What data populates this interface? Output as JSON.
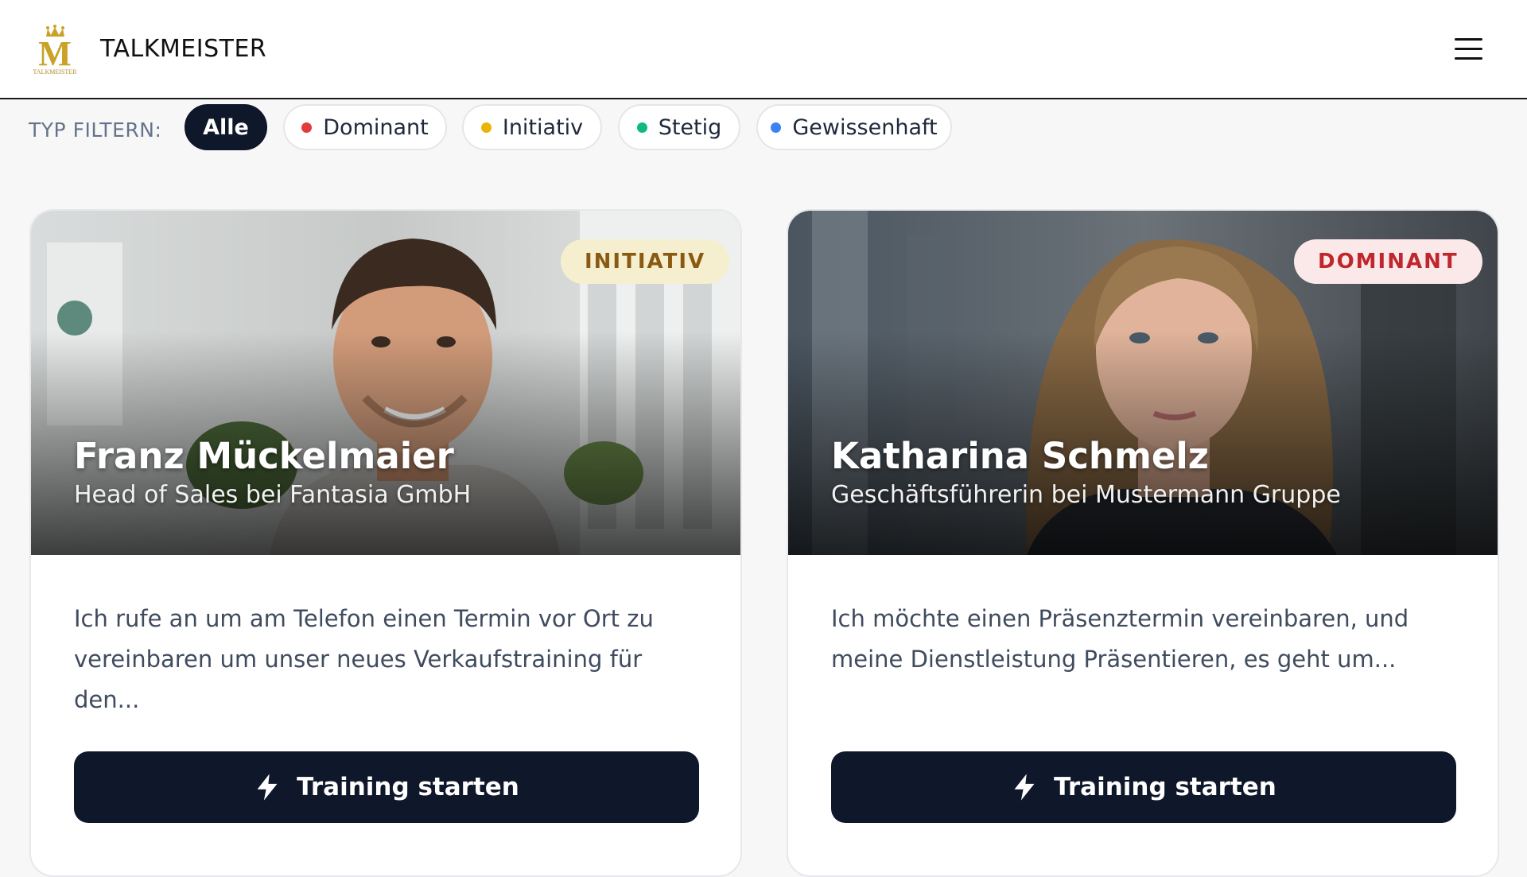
{
  "app": {
    "brand": "TALKMEISTER",
    "logo_letter": "M",
    "logo_caption": "TALKMEISTER"
  },
  "filters": {
    "label": "TYP FILTERN:",
    "options": [
      {
        "label": "Alle",
        "active": true,
        "dot_color": null
      },
      {
        "label": "Dominant",
        "active": false,
        "dot_color": "#e23b3b"
      },
      {
        "label": "Initiativ",
        "active": false,
        "dot_color": "#eab308"
      },
      {
        "label": "Stetig",
        "active": false,
        "dot_color": "#10b981"
      },
      {
        "label": "Gewissenhaft",
        "active": false,
        "dot_color": "#3b82f6"
      }
    ]
  },
  "cards": [
    {
      "badge": "INITIATIV",
      "badge_bg": "#f5efcf",
      "badge_color": "#8a5a12",
      "name": "Franz Mückelmaier",
      "role": "Head of Sales bei Fantasia GmbH",
      "description": "Ich rufe an um am Telefon einen Termin vor Ort zu vereinbaren um unser neues Verkaufstraining für den...",
      "button_label": "Training starten"
    },
    {
      "badge": "DOMINANT",
      "badge_bg": "#fbe9e9",
      "badge_color": "#c0262d",
      "name": "Katharina Schmelz",
      "role": "Geschäftsführerin bei Mustermann Gruppe",
      "description": "Ich möchte einen Präsenztermin vereinbaren, und meine Dienstleistung Präsentieren, es geht um...",
      "button_label": "Training starten"
    }
  ],
  "colors": {
    "primary": "#0f172a",
    "logo_gold": "#c9a227"
  }
}
